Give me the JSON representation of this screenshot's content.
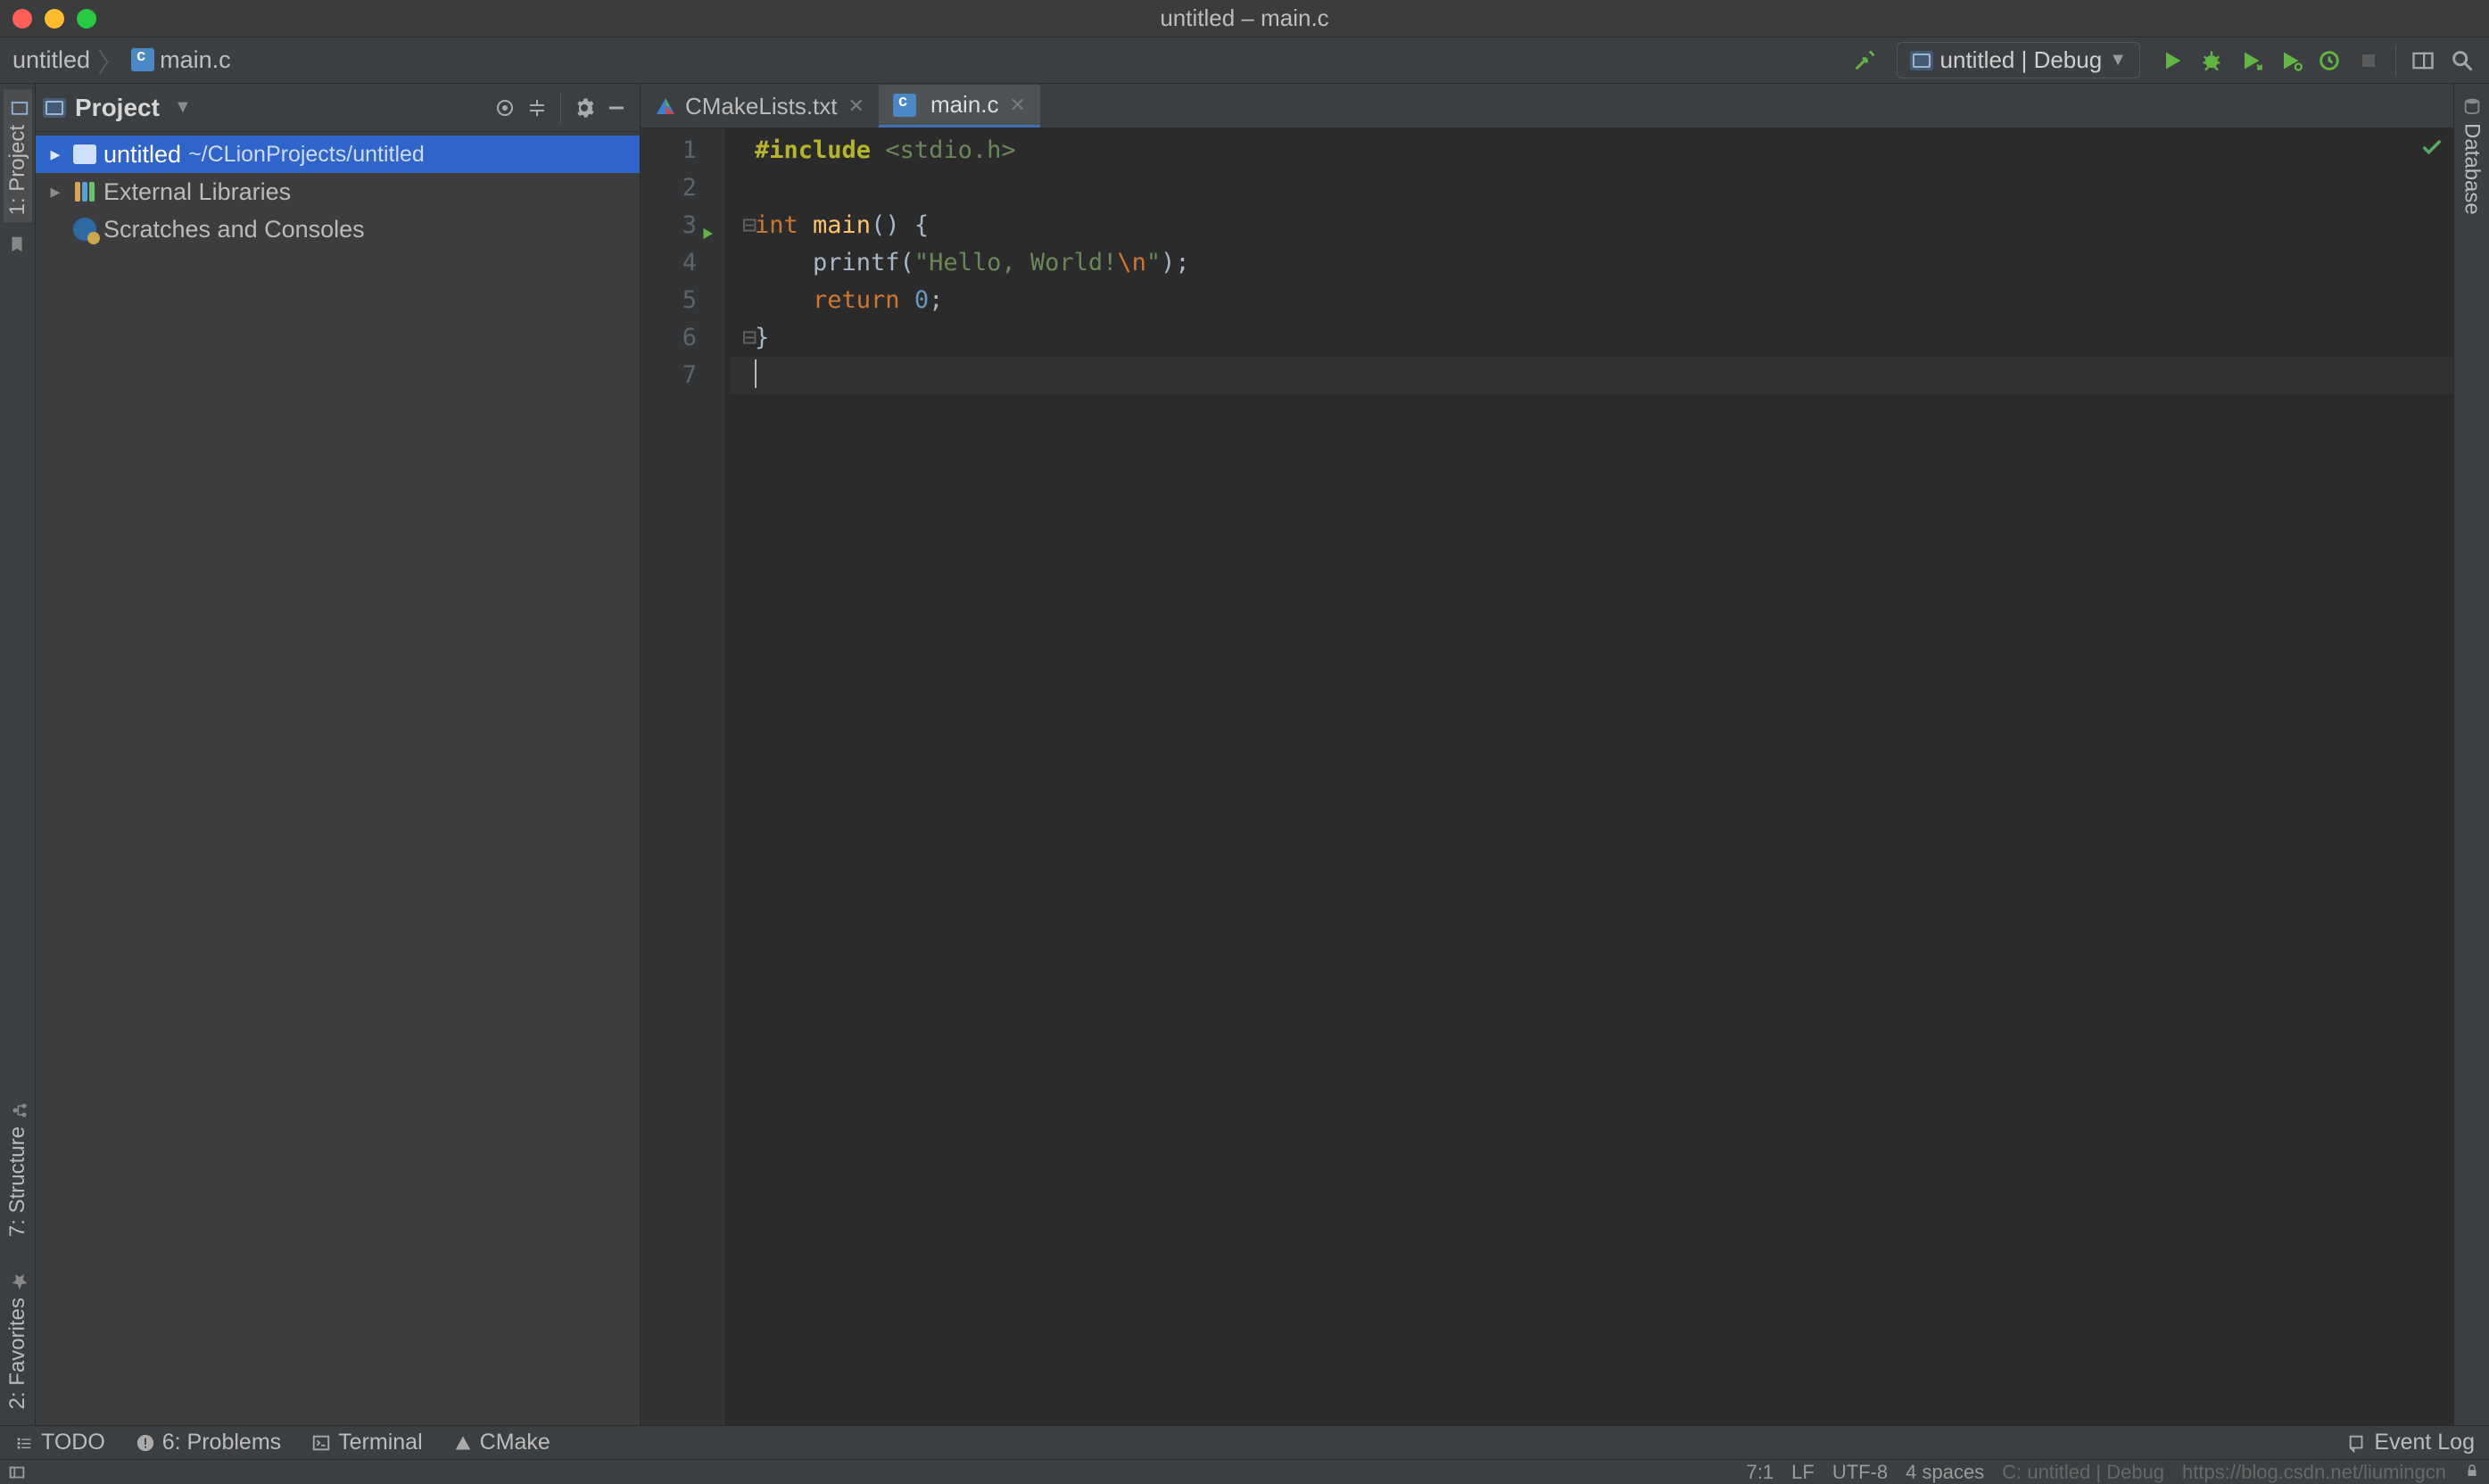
{
  "window": {
    "title": "untitled – main.c"
  },
  "breadcrumb": {
    "project": "untitled",
    "file": "main.c"
  },
  "run_config": {
    "label": "untitled | Debug"
  },
  "project_panel": {
    "title": "Project",
    "items": [
      {
        "name": "untitled",
        "path": "~/CLionProjects/untitled",
        "kind": "module",
        "selected": true,
        "expandable": true
      },
      {
        "name": "External Libraries",
        "kind": "libraries",
        "expandable": true
      },
      {
        "name": "Scratches and Consoles",
        "kind": "scratches",
        "expandable": false
      }
    ]
  },
  "tabs": [
    {
      "label": "CMakeLists.txt",
      "kind": "cmake",
      "active": false
    },
    {
      "label": "main.c",
      "kind": "c",
      "active": true
    }
  ],
  "code": {
    "lines": [
      {
        "n": 1,
        "tokens": [
          {
            "t": "#include ",
            "c": "pp"
          },
          {
            "t": "<stdio.h>",
            "c": "inc"
          }
        ]
      },
      {
        "n": 2,
        "tokens": []
      },
      {
        "n": 3,
        "run": true,
        "foldOpen": true,
        "tokens": [
          {
            "t": "int ",
            "c": "kw"
          },
          {
            "t": "main",
            "c": "fn"
          },
          {
            "t": "() {",
            "c": ""
          }
        ]
      },
      {
        "n": 4,
        "tokens": [
          {
            "t": "    ",
            "c": ""
          },
          {
            "t": "printf",
            "c": ""
          },
          {
            "t": "(",
            "c": ""
          },
          {
            "t": "\"Hello, World!",
            "c": "str"
          },
          {
            "t": "\\n",
            "c": "esc"
          },
          {
            "t": "\"",
            "c": "str"
          },
          {
            "t": ");",
            "c": ""
          }
        ]
      },
      {
        "n": 5,
        "tokens": [
          {
            "t": "    ",
            "c": ""
          },
          {
            "t": "return ",
            "c": "kw"
          },
          {
            "t": "0",
            "c": "num"
          },
          {
            "t": ";",
            "c": ""
          }
        ]
      },
      {
        "n": 6,
        "foldClose": true,
        "tokens": [
          {
            "t": "}",
            "c": ""
          }
        ]
      },
      {
        "n": 7,
        "current": true,
        "caret": true,
        "tokens": []
      }
    ]
  },
  "bottom_tools": {
    "todo": "TODO",
    "problems": "6: Problems",
    "terminal": "Terminal",
    "cmake": "CMake",
    "event_log": "Event Log"
  },
  "left_tools": {
    "project": "1: Project",
    "structure": "7: Structure",
    "favorites": "2: Favorites"
  },
  "right_tools": {
    "database": "Database"
  },
  "status": {
    "caret": "7:1",
    "line_sep": "LF",
    "encoding": "UTF-8",
    "indent": "4 spaces",
    "context": "C: untitled | Debug",
    "watermark": "https://blog.csdn.net/liumingcn"
  }
}
